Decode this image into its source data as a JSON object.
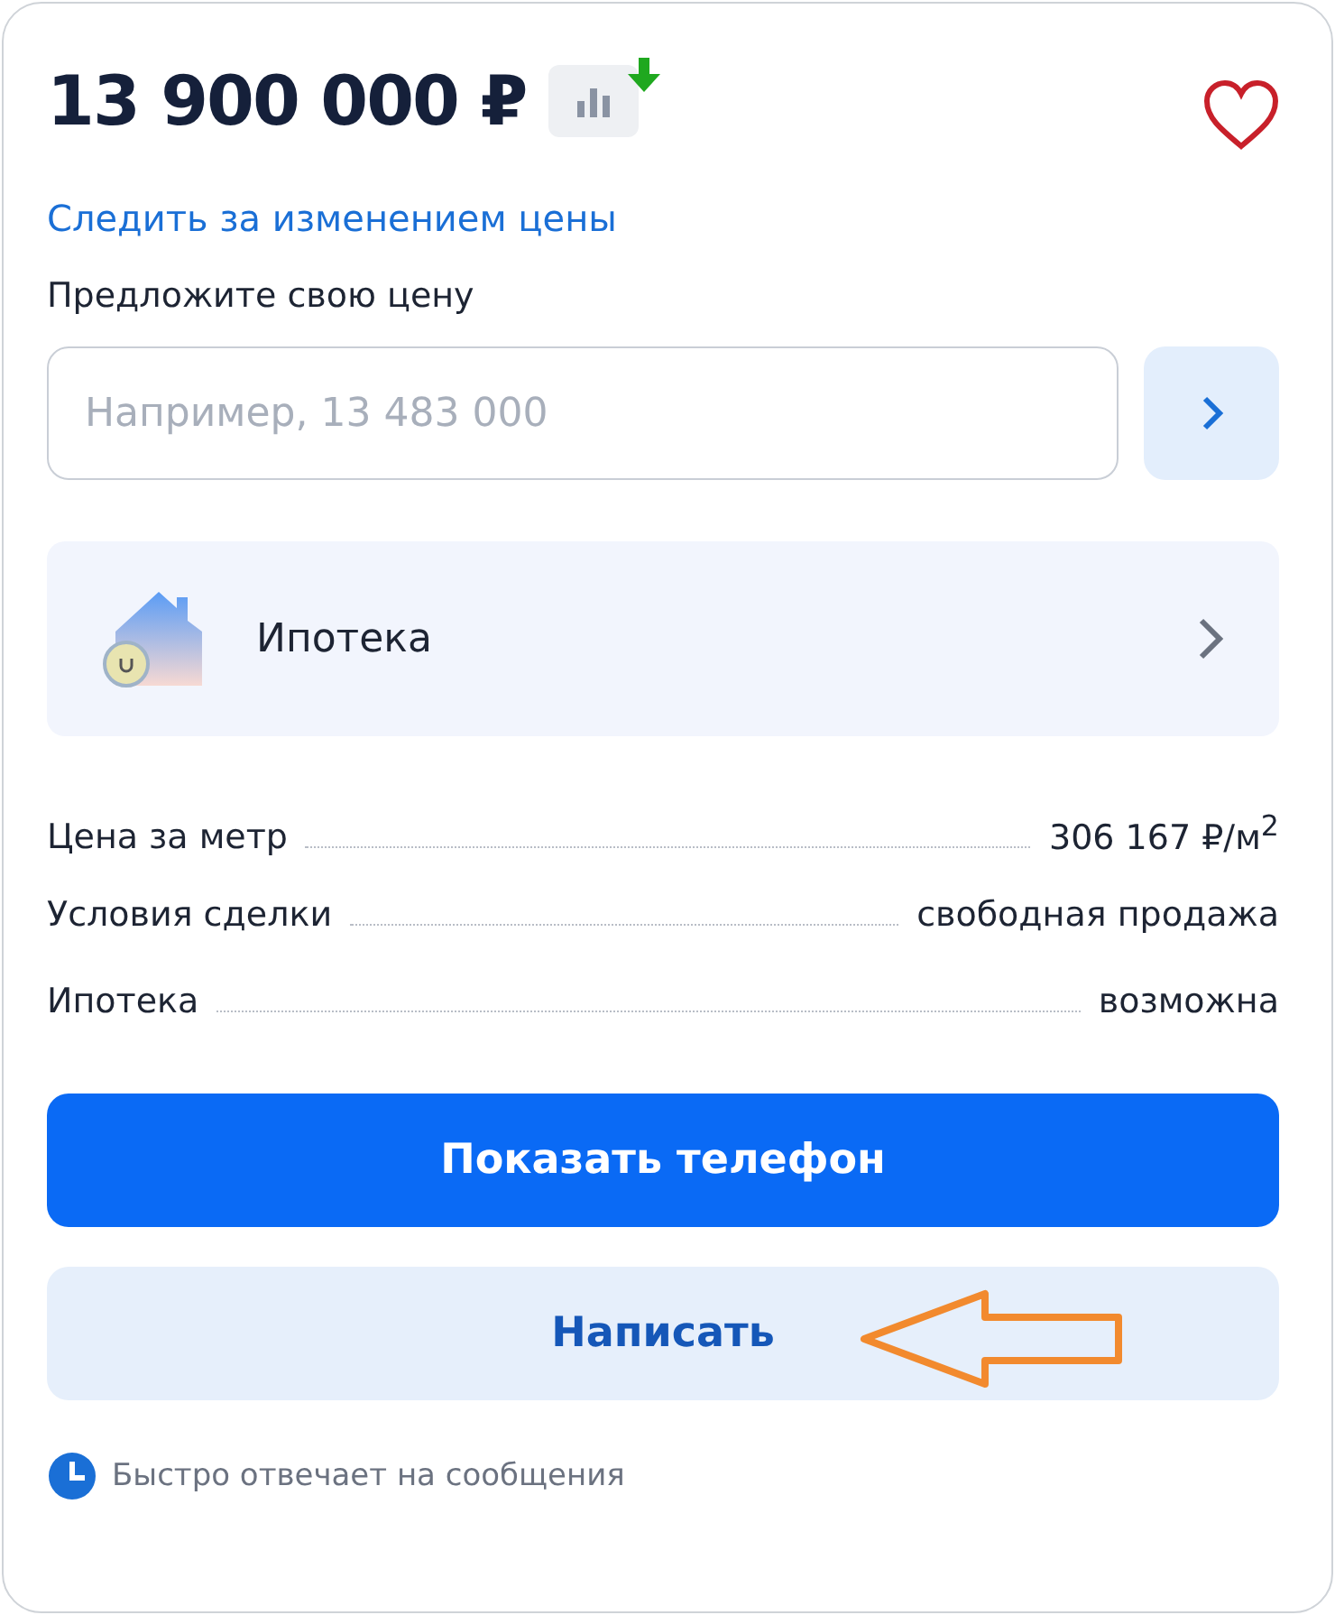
{
  "price": {
    "amount": "13 900 000 ₽",
    "dropped": true
  },
  "favorite": {
    "selected": false
  },
  "track_link": "Следить за изменением цены",
  "offer": {
    "label": "Предложите свою цену",
    "placeholder": "Например, 13 483 000"
  },
  "mortgage_card": {
    "label": "Ипотека"
  },
  "details": [
    {
      "name": "Цена за метр",
      "value": "306 167 ₽/м$^{2}$"
    },
    {
      "name": "Условия сделки",
      "value": "свободная продажа"
    },
    {
      "name": "Ипотека",
      "value": "возможна"
    }
  ],
  "buttons": [
    {
      "label": "Показать телефон",
      "kind": "primary",
      "annotated": false
    },
    {
      "label": "Написать",
      "kind": "secondary",
      "annotated": true
    }
  ],
  "note": "Быстро отвечает на сообщения"
}
